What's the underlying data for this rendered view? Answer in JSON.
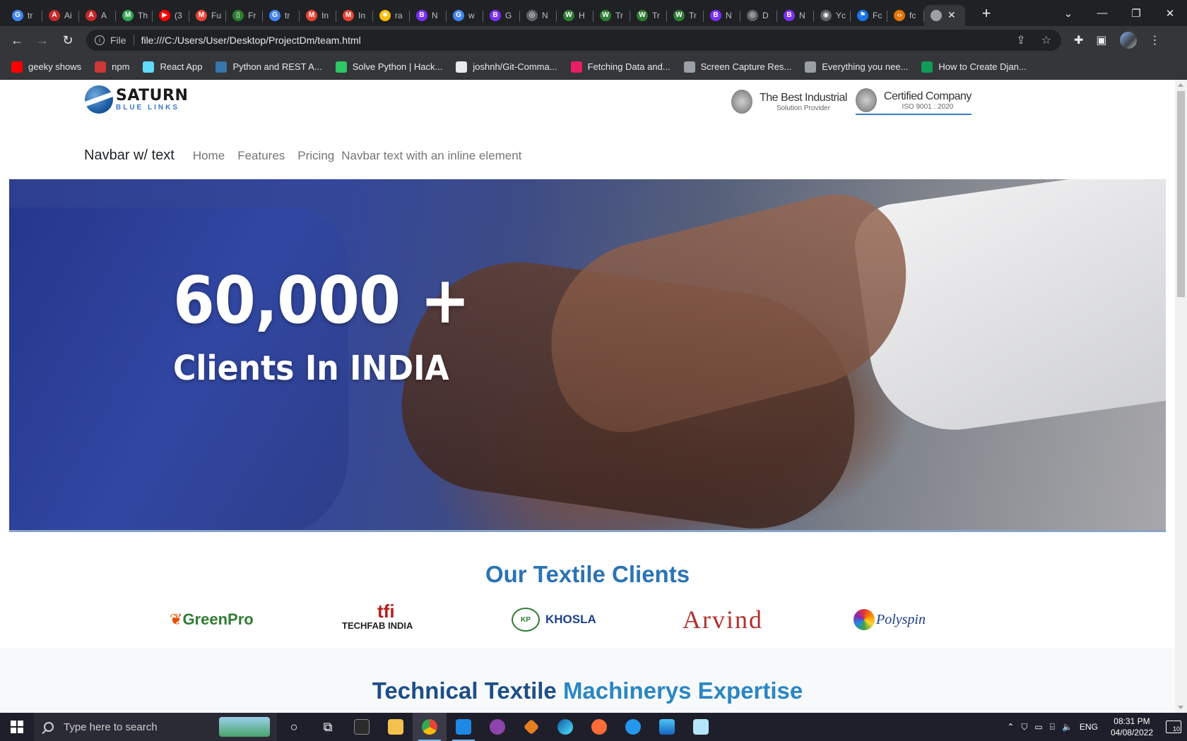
{
  "browser": {
    "tabs": [
      {
        "title": "tr",
        "color": "#4285f4",
        "glyph": "G"
      },
      {
        "title": "Ai",
        "color": "#c62828",
        "glyph": "A"
      },
      {
        "title": "A",
        "color": "#c62828",
        "glyph": "A"
      },
      {
        "title": "Th",
        "color": "#34a853",
        "glyph": "M"
      },
      {
        "title": "(3",
        "color": "#ff0000",
        "glyph": "▶"
      },
      {
        "title": "Fu",
        "color": "#ea4335",
        "glyph": "M"
      },
      {
        "title": "Fr",
        "color": "#2e7d32",
        "glyph": "▯"
      },
      {
        "title": "tr",
        "color": "#4285f4",
        "glyph": "G"
      },
      {
        "title": "In",
        "color": "#ea4335",
        "glyph": "M"
      },
      {
        "title": "In",
        "color": "#ea4335",
        "glyph": "M"
      },
      {
        "title": "ra",
        "color": "#fbbc05",
        "glyph": "✱"
      },
      {
        "title": "N",
        "color": "#7b2ff7",
        "glyph": "B"
      },
      {
        "title": "w",
        "color": "#4285f4",
        "glyph": "G"
      },
      {
        "title": "G",
        "color": "#7b2ff7",
        "glyph": "B"
      },
      {
        "title": "N",
        "color": "#5f6368",
        "glyph": "◎"
      },
      {
        "title": "H",
        "color": "#2e7d32",
        "glyph": "W"
      },
      {
        "title": "Tr",
        "color": "#2e7d32",
        "glyph": "W"
      },
      {
        "title": "Tr",
        "color": "#2e7d32",
        "glyph": "W"
      },
      {
        "title": "Tr",
        "color": "#2e7d32",
        "glyph": "W"
      },
      {
        "title": "N",
        "color": "#7b2ff7",
        "glyph": "B"
      },
      {
        "title": "D",
        "color": "#5f6368",
        "glyph": "◎"
      },
      {
        "title": "N",
        "color": "#7b2ff7",
        "glyph": "B"
      },
      {
        "title": "Yc",
        "color": "#5f6368",
        "glyph": "◉"
      },
      {
        "title": "Fc",
        "color": "#1a73e8",
        "glyph": "⚑"
      },
      {
        "title": "fc",
        "color": "#e37400",
        "glyph": "‹›"
      }
    ],
    "active_tab": {
      "title": "",
      "close": "✕"
    },
    "new_tab": "+",
    "url_scheme": "File",
    "url": "file:///C:/Users/User/Desktop/ProjectDm/team.html",
    "bookmarks": [
      {
        "label": "geeky shows",
        "color": "#ff0000"
      },
      {
        "label": "npm",
        "color": "#cb3837"
      },
      {
        "label": "React App",
        "color": "#61dafb"
      },
      {
        "label": "Python and REST A...",
        "color": "#3776ab"
      },
      {
        "label": "Solve Python | Hack...",
        "color": "#2ec866"
      },
      {
        "label": "joshnh/Git-Comma...",
        "color": "#e8eaed"
      },
      {
        "label": "Fetching Data and...",
        "color": "#e91e63"
      },
      {
        "label": "Screen Capture Res...",
        "color": "#9aa0a6"
      },
      {
        "label": "Everything you nee...",
        "color": "#9aa0a6"
      },
      {
        "label": "How to Create Djan...",
        "color": "#0f9d58"
      }
    ]
  },
  "site": {
    "logo_line1": "SATURN",
    "logo_line2": "BLUE LINKS",
    "award1_title": "The Best Industrial",
    "award1_sub": "Solution Provider",
    "award2_title": "Certified Company",
    "award2_sub": "ISO 9001 : 2020",
    "navbar": {
      "brand": "Navbar w/ text",
      "links": [
        "Home",
        "Features",
        "Pricing"
      ],
      "text": "Navbar text with an inline element"
    },
    "hero": {
      "headline": "60,000 +",
      "subline": "Clients In INDIA"
    },
    "clients_title": "Our Textile Clients",
    "clients": [
      "GreenPro",
      "TECHFAB INDIA",
      "KHOSLA",
      "Arvind",
      "Polyspin"
    ],
    "section2_title_a": "Technical Textile ",
    "section2_title_b": "Machinerys Expertise"
  },
  "taskbar": {
    "search_placeholder": "Type here to search",
    "lang": "ENG",
    "time": "08:31 PM",
    "date": "04/08/2022",
    "notifications": "10"
  }
}
